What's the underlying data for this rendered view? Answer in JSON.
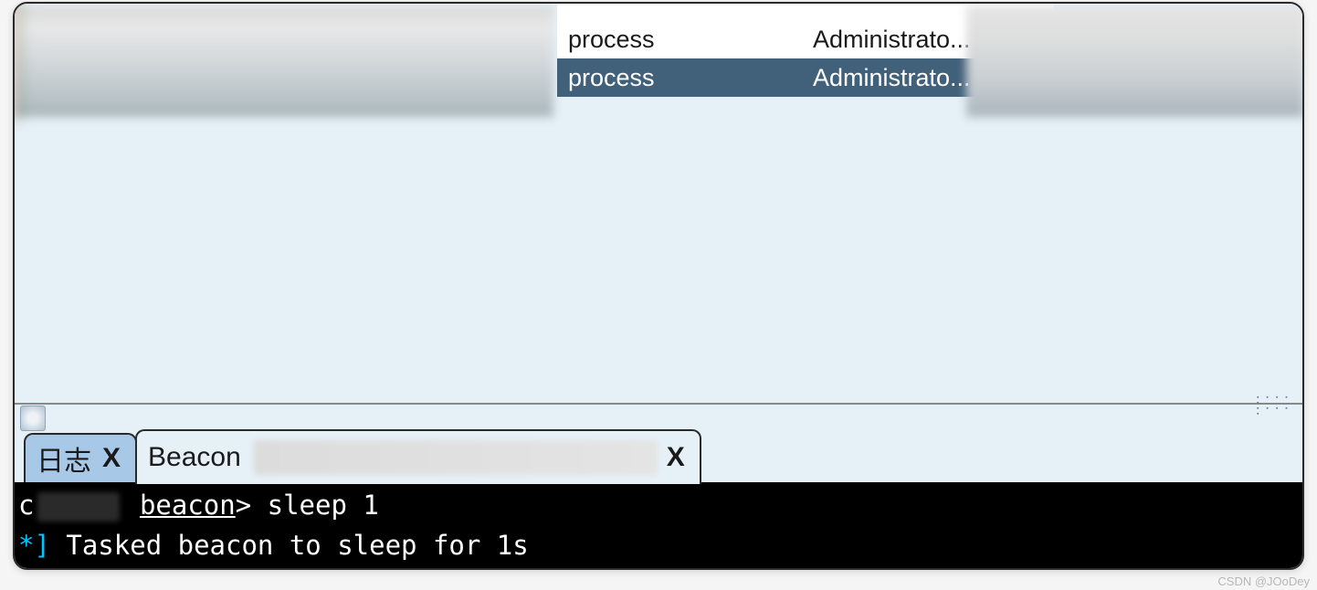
{
  "table": {
    "rows": [
      {
        "name": "process",
        "user": "Administrato...",
        "selected": false
      },
      {
        "name": "process",
        "user": "Administrato...",
        "selected": true
      }
    ]
  },
  "tabs": [
    {
      "label": "日志",
      "close": "X",
      "active": false
    },
    {
      "label": "Beacon ",
      "close": "X",
      "active": true
    }
  ],
  "console": {
    "prompt_prefix": "c",
    "prompt_name": "beacon",
    "prompt_suffix": ">",
    "command": "sleep 1",
    "resp_bracket_open": "*]",
    "response": "Tasked beacon to sleep for 1s"
  },
  "watermark": "CSDN @JOoDey"
}
